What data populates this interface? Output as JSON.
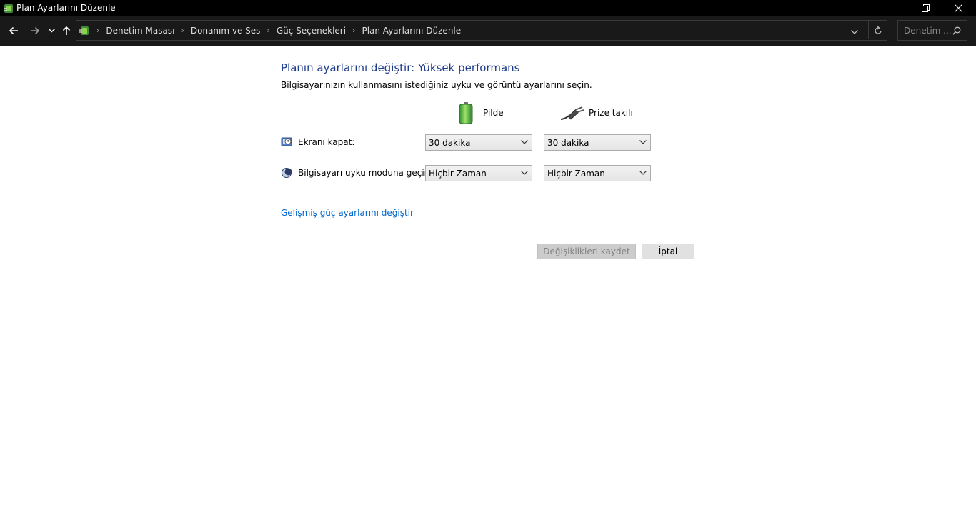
{
  "window": {
    "title": "Plan Ayarlarını Düzenle"
  },
  "breadcrumb": [
    "Denetim Masası",
    "Donanım ve Ses",
    "Güç Seçenekleri",
    "Plan Ayarlarını Düzenle"
  ],
  "search": {
    "placeholder": "Denetim ..."
  },
  "page": {
    "heading": "Planın ayarlarını değiştir: Yüksek performans",
    "description": "Bilgisayarınızın kullanmasını istediğiniz uyku ve görüntü ayarlarını seçin.",
    "columns": {
      "battery": "Pilde",
      "plugged": "Prize takılı"
    },
    "settings": [
      {
        "label": "Ekranı kapat:",
        "battery": "30 dakika",
        "plugged": "30 dakika"
      },
      {
        "label": "Bilgisayarı uyku moduna geçir:",
        "battery": "Hiçbir Zaman",
        "plugged": "Hiçbir Zaman"
      }
    ],
    "advanced_link": "Gelişmiş güç ayarlarını değiştir",
    "save_button": "Değişiklikleri kaydet",
    "cancel_button": "İptal"
  },
  "colors": {
    "heading": "#1e3c8c",
    "link": "#0066cc",
    "titlebar": "#000000",
    "navbar": "#191919"
  }
}
